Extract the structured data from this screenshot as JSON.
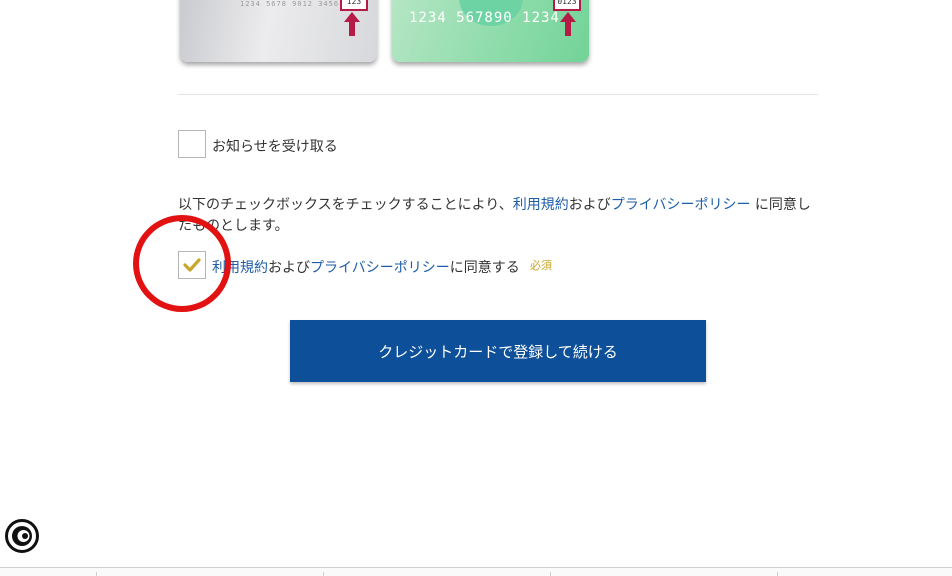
{
  "cards": {
    "gray": {
      "number_faint": "1234 5678 9012 3456",
      "cvv": "123"
    },
    "green": {
      "number": "1234  567890  1234",
      "cvv": "0123"
    }
  },
  "newsletter": {
    "label": "お知らせを受け取る",
    "checked": false
  },
  "notice": {
    "prefix": "以下のチェックボックスをチェックすることにより、",
    "terms_link": "利用規約",
    "and": "および",
    "privacy_link": "プライバシーポリシー",
    "suffix": " に同意したものとします。"
  },
  "agree": {
    "terms_link": "利用規約",
    "and": "および",
    "privacy_link": "プライバシーポリシー",
    "suffix": "に同意する",
    "required": "必須",
    "checked": true
  },
  "submit": {
    "label": "クレジットカードで登録して続ける"
  },
  "colors": {
    "primary": "#0d4f99",
    "link": "#1e5ea8",
    "check": "#c9a62b",
    "highlight_circle": "#e31212"
  },
  "icons": [
    "up-arrow-icon",
    "checkmark-icon",
    "chat-support-icon"
  ]
}
